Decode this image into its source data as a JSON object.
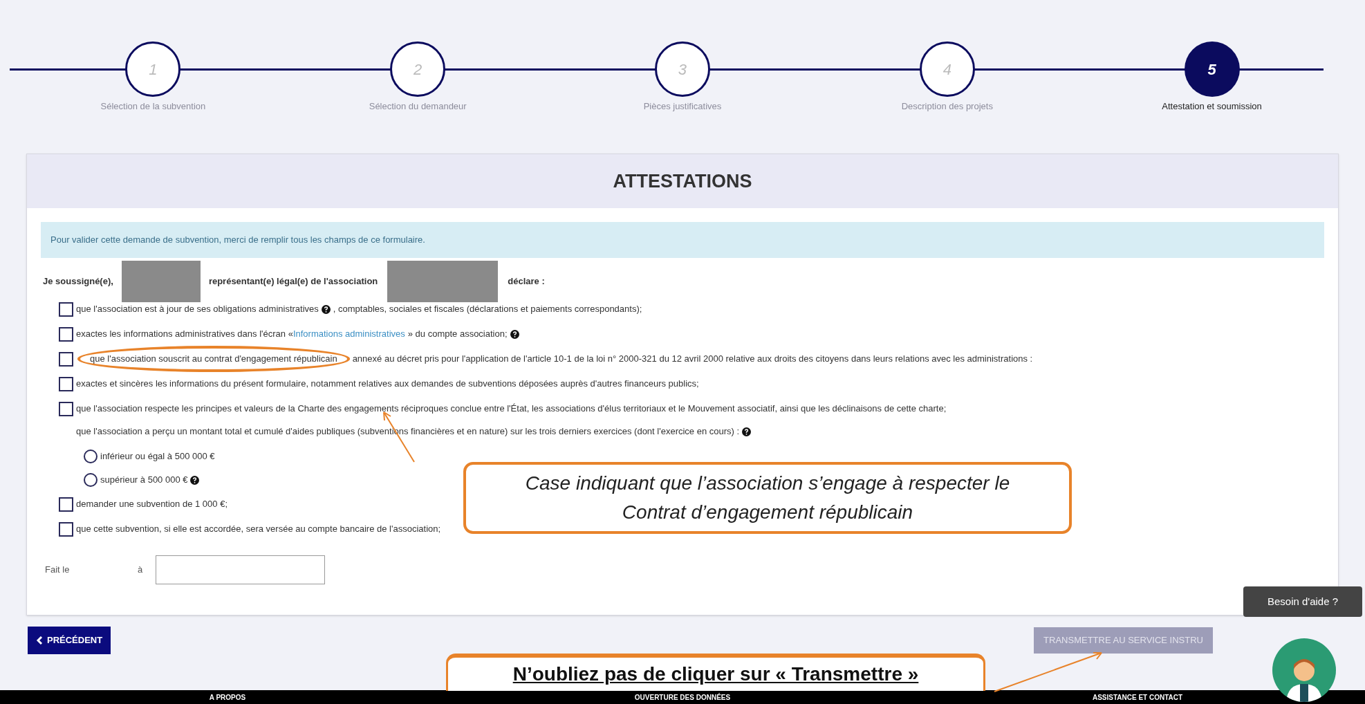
{
  "stepper": [
    {
      "number": "1",
      "label": "Sélection de la subvention",
      "selected": false
    },
    {
      "number": "2",
      "label": "Sélection du demandeur",
      "selected": false
    },
    {
      "number": "3",
      "label": "Pièces justificatives",
      "selected": false
    },
    {
      "number": "4",
      "label": "Description des projets",
      "selected": false
    },
    {
      "number": "5",
      "label": "Attestation et soumission",
      "selected": true
    }
  ],
  "panel": {
    "title": "ATTESTATIONS",
    "info": "Pour valider cette demande de subvention, merci de remplir tous les champs de ce formulaire.",
    "declaration": {
      "prefix": "Je soussigné(e),",
      "middle": "représentant(e) légal(e) de l'association",
      "suffix": "déclare :"
    },
    "items": [
      {
        "kind": "checkbox",
        "checked": false,
        "parts": [
          {
            "kind": "text",
            "text": "que l'association est à jour de ses obligations administratives"
          },
          {
            "kind": "help"
          },
          {
            "kind": "text",
            "text": ", comptables, sociales et fiscales (déclarations et paiements correspondants);"
          }
        ]
      },
      {
        "kind": "checkbox",
        "checked": false,
        "parts": [
          {
            "kind": "text",
            "text": "exactes les informations administratives dans l'écran «"
          },
          {
            "kind": "link",
            "text": "Informations administratives"
          },
          {
            "kind": "text",
            "text": "» du compte association;"
          },
          {
            "kind": "help"
          }
        ]
      },
      {
        "kind": "checkbox",
        "checked": false,
        "parts": [
          {
            "kind": "circled",
            "text": "que l'association souscrit au contrat d'engagement républicain"
          },
          {
            "kind": "text",
            "text": "annexé au décret pris pour l'application de l'article 10-1 de la loi n° 2000-321 du 12 avril 2000 relative aux droits des citoyens dans leurs relations avec les administrations :"
          }
        ]
      },
      {
        "kind": "checkbox",
        "checked": false,
        "parts": [
          {
            "kind": "text",
            "text": "exactes et sincères les informations du présent formulaire, notamment relatives aux demandes de subventions déposées auprès d'autres financeurs publics;"
          }
        ]
      },
      {
        "kind": "checkbox",
        "checked": false,
        "parts": [
          {
            "kind": "text",
            "text": "que l'association respecte les principes et valeurs de la Charte des engagements réciproques conclue entre l'État, les associations d'élus territoriaux et le Mouvement associatif, ainsi que les déclinaisons de cette charte;"
          }
        ]
      },
      {
        "kind": "note",
        "parts": [
          {
            "kind": "text",
            "text": "que l'association a perçu un montant total et cumulé d'aides publiques (subventions financières et en nature) sur les trois derniers exercices (dont l'exercice en cours) :"
          },
          {
            "kind": "help"
          }
        ]
      },
      {
        "kind": "radio",
        "selected": false,
        "parts": [
          {
            "kind": "text",
            "text": "inférieur ou égal à 500 000 €"
          }
        ]
      },
      {
        "kind": "radio",
        "selected": false,
        "parts": [
          {
            "kind": "text",
            "text": "supérieur à 500 000 €"
          },
          {
            "kind": "help"
          }
        ]
      },
      {
        "kind": "checkbox",
        "checked": false,
        "parts": [
          {
            "kind": "text",
            "text": "demander une subvention de 1 000 €;"
          }
        ]
      },
      {
        "kind": "checkbox",
        "checked": false,
        "parts": [
          {
            "kind": "text",
            "text": "que cette subvention, si elle est accordée, sera versée au compte bancaire de l'association;"
          }
        ]
      }
    ],
    "date": {
      "label": "Fait le",
      "place_label": "à"
    }
  },
  "buttons": {
    "previous": {
      "label": "PRÉCÉDENT"
    },
    "submit": {
      "label": "TRANSMETTRE AU SERVICE INSTRU",
      "disabled": true
    }
  },
  "help_widget": {
    "tooltip": "Besoin d'aide ?"
  },
  "footer": [
    "A PROPOS",
    "OUVERTURE DES DONNÉES",
    "ASSISTANCE ET CONTACT"
  ],
  "annotations": [
    {
      "kind": "italic",
      "text": "Case indiquant que l’association s’engage à respecter le Contrat d’engagement républicain"
    },
    {
      "kind": "bold",
      "text": "N’oubliez pas de cliquer sur « Transmettre »"
    }
  ]
}
